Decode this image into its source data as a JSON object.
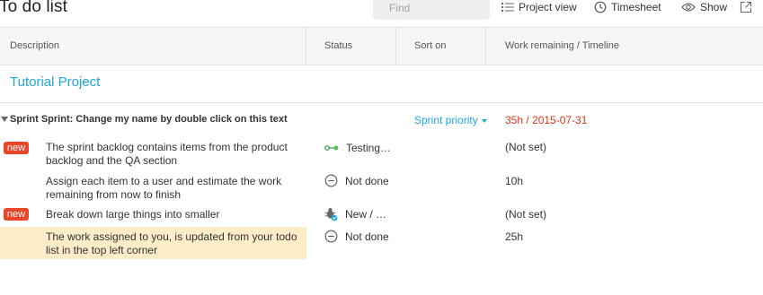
{
  "toolbar": {
    "title": "To do list",
    "find_placeholder": "Find",
    "project_view": "Project view",
    "timesheet": "Timesheet",
    "show": "Show"
  },
  "columns": {
    "description": "Description",
    "status": "Status",
    "sort_on": "Sort on",
    "work": "Work remaining / Timeline"
  },
  "project": {
    "title": "Tutorial Project"
  },
  "sprint": {
    "title": "Sprint Sprint: Change my name by double click on this text",
    "sort": "Sprint priority",
    "work": "35h / 2015-07-31",
    "accent": "#e2351d"
  },
  "items": [
    {
      "badge": "new",
      "line1": "The sprint backlog contains items from the product",
      "line2": "backlog and the QA section",
      "status": "Testing…",
      "status_icon": "testing-icon",
      "work": "(Not set)"
    },
    {
      "badge": "",
      "line1": "Assign each item to a user and estimate the work",
      "line2": "remaining from now to finish",
      "status": "Not done",
      "status_icon": "not-done-icon",
      "work": "10h"
    },
    {
      "badge": "new",
      "line1": "Break down large things into smaller",
      "line2": "",
      "status": "New  /  …",
      "status_icon": "bug-icon",
      "work": "(Not set)"
    },
    {
      "badge": "",
      "line1": "The work assigned to you, is updated from your todo",
      "line2": "list in the top left corner",
      "status": "Not done",
      "status_icon": "not-done-icon",
      "work": "25h",
      "highlighted": true
    }
  ],
  "colors": {
    "link": "#1ea7e0",
    "badge": "#e8452a",
    "highlight": "#fdecc8"
  }
}
